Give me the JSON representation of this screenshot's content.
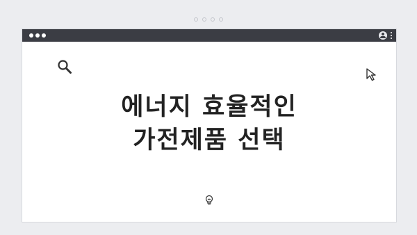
{
  "pager": {
    "dot_count": 4
  },
  "window": {
    "titlebar": {
      "traffic_lights": [
        "dot",
        "dot",
        "dot"
      ],
      "icons": [
        "user-icon",
        "kebab-menu-icon"
      ]
    },
    "content": {
      "headline_line1": "에너지 효율적인",
      "headline_line2": "가전제품 선택",
      "icons": [
        "search-icon",
        "cursor-arrow-icon",
        "lightbulb-icon"
      ]
    }
  },
  "colors": {
    "background": "#ecedf0",
    "titlebar": "#3b3d44",
    "text": "#222222",
    "window": "#ffffff"
  }
}
